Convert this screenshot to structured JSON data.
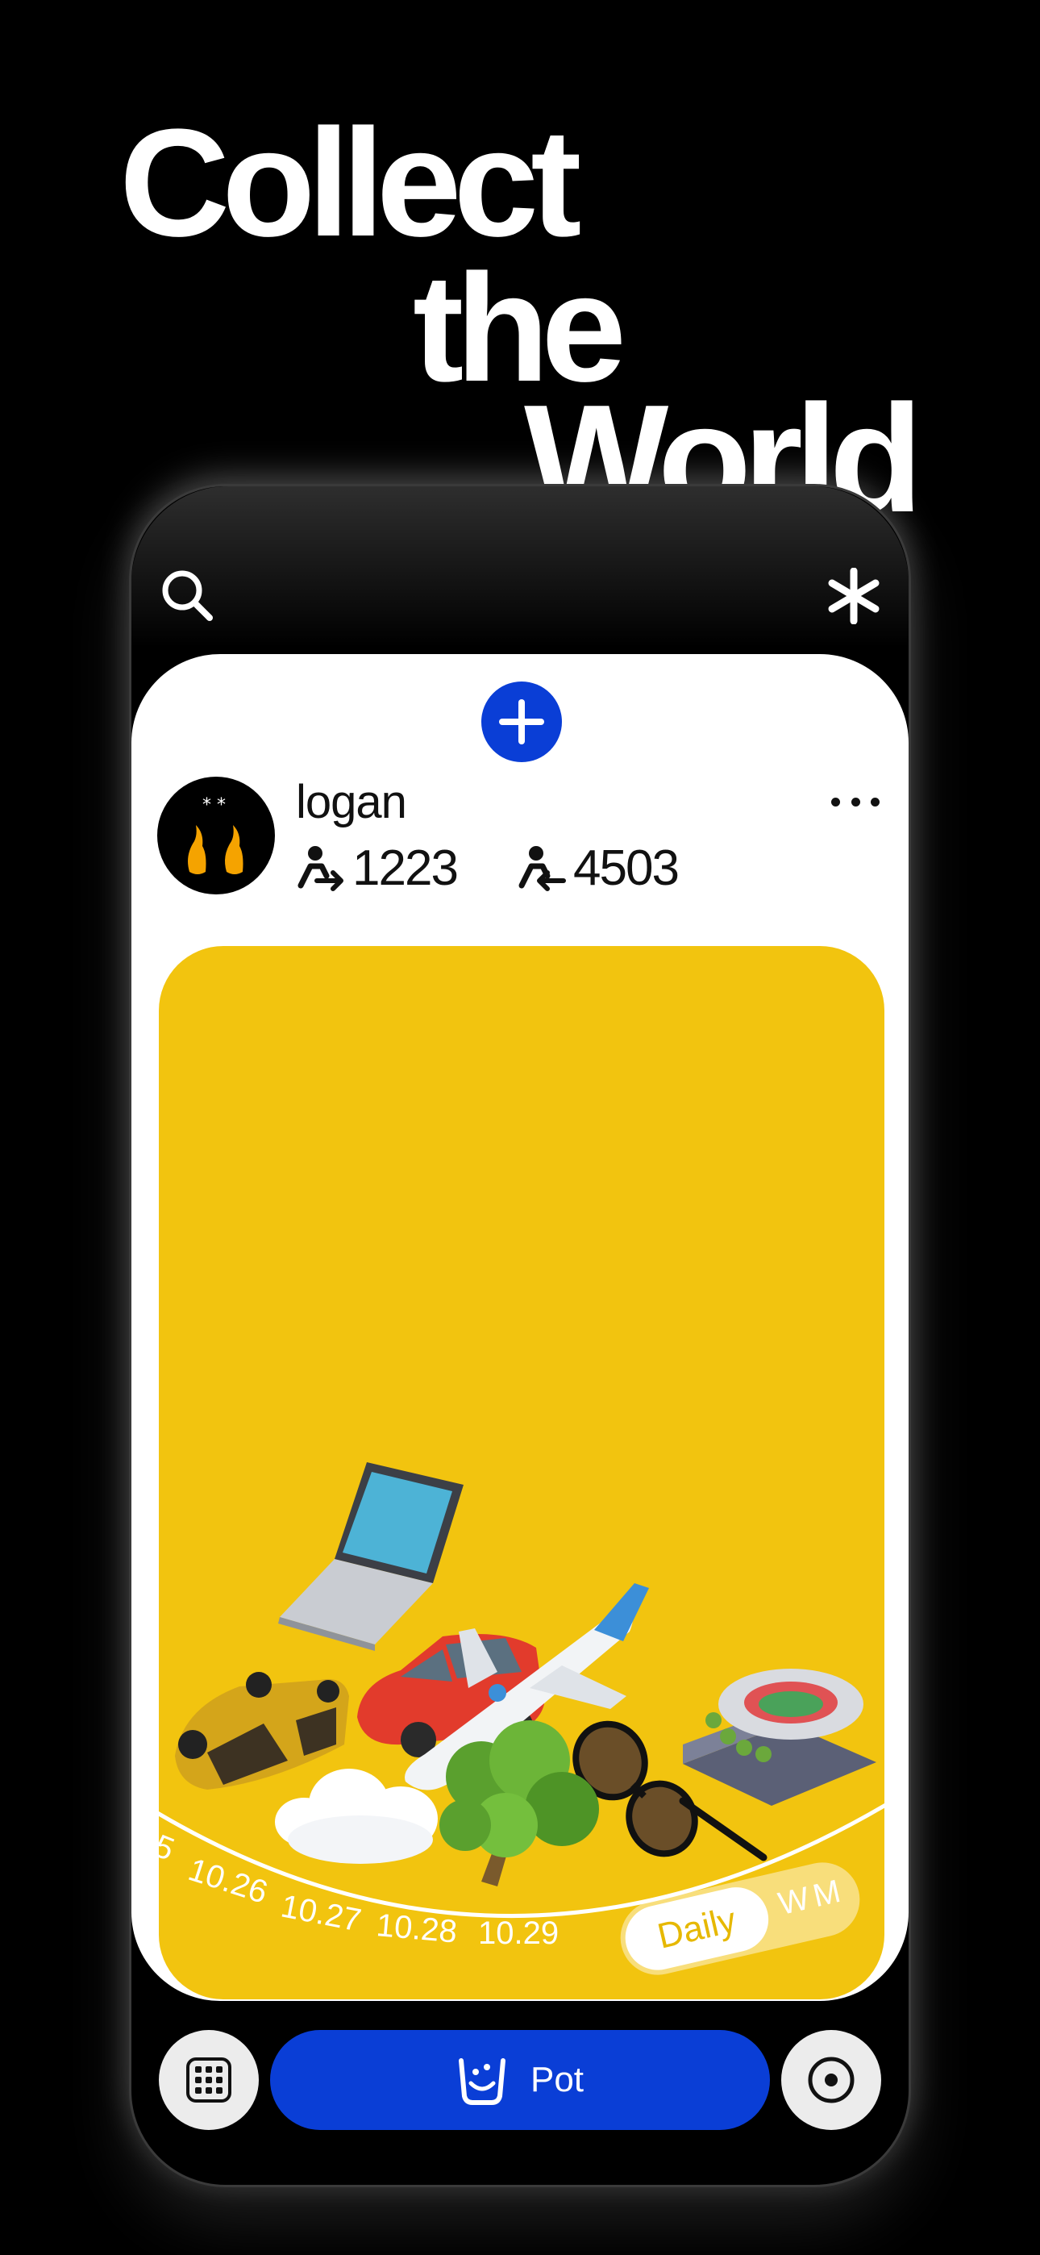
{
  "headline": {
    "line1": "Collect",
    "line2": "the",
    "line3": "World"
  },
  "topbar": {
    "search_icon": "search-icon",
    "menu_icon": "asterisk-icon"
  },
  "profile": {
    "username": "logan",
    "following_count": "1223",
    "followers_count": "4503"
  },
  "timeline": {
    "dates": [
      "5",
      "10.26",
      "10.27",
      "10.28",
      "10.29"
    ],
    "toggle": {
      "daily": "Daily",
      "weekly": "W",
      "monthly": "M"
    }
  },
  "bottom_bar": {
    "pot_label": "Pot"
  },
  "colors": {
    "accent_blue": "#0a3ed6",
    "canvas_yellow": "#f2c40f"
  }
}
